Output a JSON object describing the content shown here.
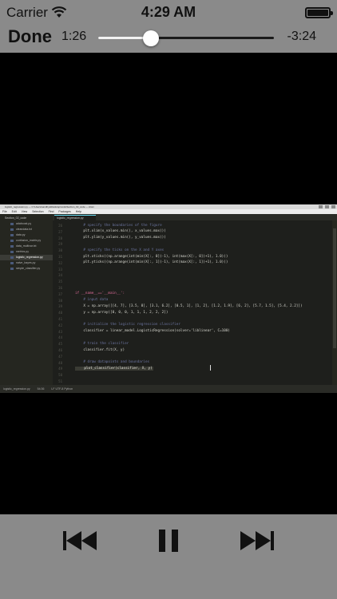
{
  "status_bar": {
    "carrier": "Carrier",
    "time": "4:29 AM"
  },
  "player": {
    "done_label": "Done",
    "elapsed": "1:26",
    "remaining": "-3:24",
    "progress_fraction": 0.3
  },
  "video_frame": {
    "window_title": "logistic_regression.py — C:\\Users\\sandhya\\Desktop\\code\\Section_02_code — Atom",
    "menu": [
      "File",
      "Edit",
      "View",
      "Selection",
      "Find",
      "Packages",
      "Help"
    ],
    "project_root": "Section_02_code",
    "files": [
      "adaboost.py",
      "cleandata.txt",
      "data.py",
      "confusion_matrix.py",
      "data_multivar.txt",
      "metrics.py",
      "logistic_regression.py",
      "naive_bayes.py",
      "simple_classifier.py"
    ],
    "selected_file": "logistic_regression.py",
    "active_tab": "logistic_regression.py",
    "line_numbers": [
      "26",
      "27",
      "28",
      "29",
      "30",
      "31",
      "32",
      "33",
      "34",
      "35",
      "36",
      "37",
      "38",
      "39",
      "40",
      "41",
      "42",
      "43",
      "44",
      "45",
      "46",
      "47",
      "48",
      "49",
      "50",
      "51",
      "52",
      "53",
      "54"
    ],
    "current_line": "54",
    "code": [
      {
        "line": "26",
        "text": "    # specify the boundaries of the figure",
        "style": "comment"
      },
      {
        "line": "27",
        "text": "    plt.xlim(x_values.min(), x_values.max())",
        "style": "plain"
      },
      {
        "line": "28",
        "text": "    plt.ylim(y_values.min(), y_values.max())",
        "style": "plain"
      },
      {
        "line": "30",
        "text": "    # specify the ticks on the X and Y axes",
        "style": "comment"
      },
      {
        "line": "31",
        "text": "    plt.xticks((np.arange(int(min(X[:, 0])-1), int(max(X[:, 0])+1), 1.0)))",
        "style": "plain"
      },
      {
        "line": "32",
        "text": "    plt.yticks((np.arange(int(min(X[:, 1])-1), int(max(X[:, 1])+1), 1.0)))",
        "style": "plain"
      },
      {
        "line": "37",
        "text": "if __name__=='__main__':",
        "style": "kw"
      },
      {
        "line": "38",
        "text": "    # input data",
        "style": "comment"
      },
      {
        "line": "39",
        "text": "    X = np.array([[4, 7], [3.5, 8], [3.1, 6.2], [0.5, 1], [1, 2], [1.2, 1.9], [6, 2], [5.7, 1.5], [5.4, 2.2]])",
        "style": "plain"
      },
      {
        "line": "40",
        "text": "    y = np.array([0, 0, 0, 1, 1, 1, 2, 2, 2])",
        "style": "plain"
      },
      {
        "line": "42",
        "text": "    # initialize the logistic regression classifier",
        "style": "comment"
      },
      {
        "line": "43",
        "text": "    classifier = linear_model.LogisticRegression(solver='liblinear', C=100)",
        "style": "plain"
      },
      {
        "line": "45",
        "text": "    # train the classifier",
        "style": "comment"
      },
      {
        "line": "46",
        "text": "    classifier.fit(X, y)",
        "style": "plain"
      },
      {
        "line": "48",
        "text": "    # draw datapoints and boundaries",
        "style": "comment"
      },
      {
        "line": "49",
        "text": "    plot_classifier(classifier, X, y)",
        "style": "cur"
      }
    ],
    "status_file": "logistic_regression.py",
    "status_pos": "54:36",
    "status_extra": "LF  UTF-8  Python"
  }
}
